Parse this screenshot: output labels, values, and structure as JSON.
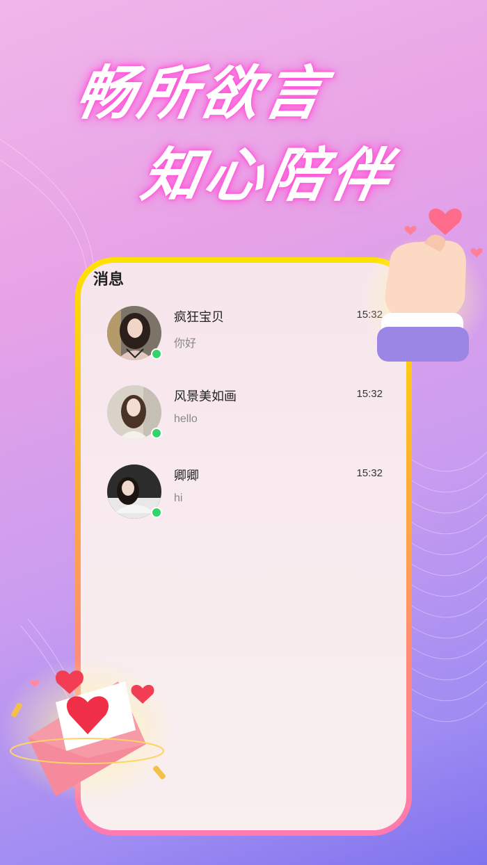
{
  "headline": {
    "line1": "畅所欲言",
    "line2": "知心陪伴"
  },
  "screen": {
    "title": "消息"
  },
  "chats": [
    {
      "name": "疯狂宝贝",
      "message": "你好",
      "time": "15:32",
      "online": true
    },
    {
      "name": "风景美如画",
      "message": "hello",
      "time": "15:32",
      "online": true
    },
    {
      "name": "卿卿",
      "message": "hi",
      "time": "15:32",
      "online": true
    }
  ],
  "colors": {
    "online": "#34d36b",
    "glow": "#ff4fd6",
    "frame_top": "#ffe200",
    "frame_bottom": "#ff7ab0"
  }
}
